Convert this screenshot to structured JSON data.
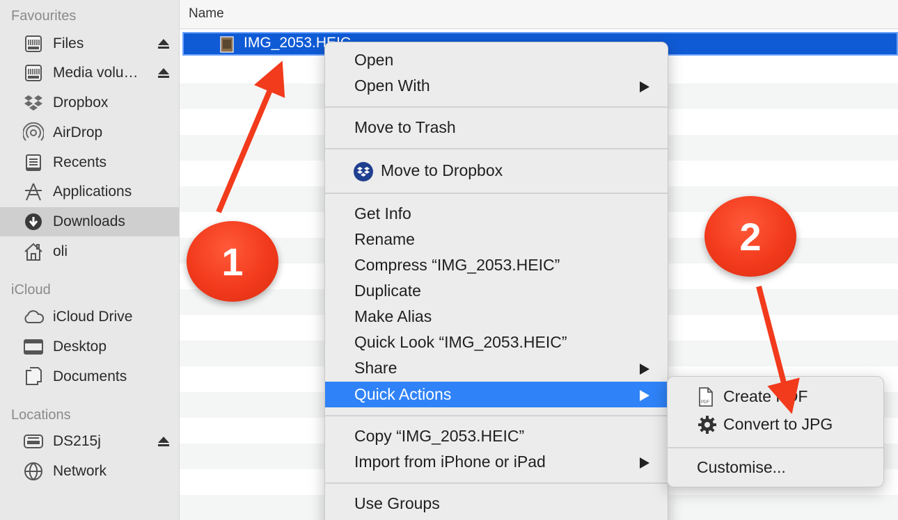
{
  "sidebar": {
    "sections": [
      {
        "title": "Favourites"
      },
      {
        "title": "iCloud"
      },
      {
        "title": "Locations"
      }
    ],
    "items": [
      {
        "label": "Files",
        "icon": "drive-icon",
        "eject": true
      },
      {
        "label": "Media volu…",
        "icon": "drive-icon",
        "eject": true
      },
      {
        "label": "Dropbox",
        "icon": "dropbox-icon"
      },
      {
        "label": "AirDrop",
        "icon": "airdrop-icon"
      },
      {
        "label": "Recents",
        "icon": "recents-icon"
      },
      {
        "label": "Applications",
        "icon": "applications-icon"
      },
      {
        "label": "Downloads",
        "icon": "downloads-icon",
        "active": true
      },
      {
        "label": "oli",
        "icon": "home-icon"
      },
      {
        "label": "iCloud Drive",
        "icon": "cloud-icon"
      },
      {
        "label": "Desktop",
        "icon": "desktop-icon"
      },
      {
        "label": "Documents",
        "icon": "documents-icon"
      },
      {
        "label": "DS215j",
        "icon": "nas-icon",
        "eject": true
      },
      {
        "label": "Network",
        "icon": "network-icon"
      }
    ]
  },
  "filelist": {
    "column_header": "Name",
    "selected_file": "IMG_2053.HEIC"
  },
  "context_menu": {
    "items": [
      {
        "label": "Open"
      },
      {
        "label": "Open With",
        "submenu": true
      },
      {
        "label": "Move to Trash"
      },
      {
        "label": "Move to Dropbox",
        "icon": "dropbox-icon"
      },
      {
        "label": "Get Info"
      },
      {
        "label": "Rename"
      },
      {
        "label": "Compress “IMG_2053.HEIC”"
      },
      {
        "label": "Duplicate"
      },
      {
        "label": "Make Alias"
      },
      {
        "label": "Quick Look “IMG_2053.HEIC”"
      },
      {
        "label": "Share",
        "submenu": true
      },
      {
        "label": "Quick Actions",
        "submenu": true,
        "highlighted": true
      },
      {
        "label": "Copy “IMG_2053.HEIC”"
      },
      {
        "label": "Import from iPhone or iPad",
        "submenu": true
      },
      {
        "label": "Use Groups"
      }
    ]
  },
  "quick_actions_submenu": {
    "items": [
      {
        "label": "Create PDF",
        "icon": "pdf-file-icon"
      },
      {
        "label": "Convert to JPG",
        "icon": "gear-icon"
      },
      {
        "label": "Customise..."
      }
    ]
  },
  "annotations": {
    "badge_1": "1",
    "badge_2": "2",
    "color": "#f23a1c"
  },
  "colors": {
    "selection": "#0f5bd6",
    "menu_highlight": "#2f82f7",
    "sidebar_bg": "#e9e8e8"
  }
}
